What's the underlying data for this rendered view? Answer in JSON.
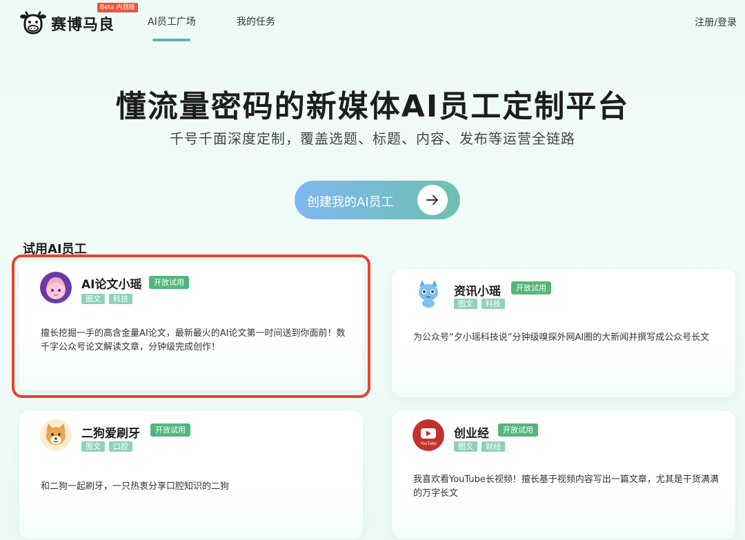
{
  "header": {
    "brand": "赛博马良",
    "beta": "Beta 内测版",
    "nav": [
      "AI员工广场",
      "我的任务"
    ],
    "login": "注册/登录"
  },
  "hero": {
    "title": "懂流量密码的新媒体AI员工定制平台",
    "subtitle": "千号千面深度定制，覆盖选题、标题、内容、发布等运营全链路",
    "cta": "创建我的AI员工"
  },
  "section": {
    "title": "试用AI员工"
  },
  "cards": [
    {
      "name": "AI论文小瑶",
      "badge": "开放试用",
      "tags": [
        "图文",
        "科技"
      ],
      "desc": "擅长挖掘一手的高含金量AI论文，最新最火的AI论文第一时间送到你面前！数千字公众号论文解读文章，分钟级完成创作！",
      "avatar": "anime-girl-avatar"
    },
    {
      "name": "资讯小瑶",
      "badge": "开放试用",
      "tags": [
        "图文",
        "科技"
      ],
      "desc": "为公众号“夕小瑶科技说”分钟级嗅探外网AI圈的大新闻并撰写成公众号长文",
      "avatar": "blue-dragon-avatar"
    },
    {
      "name": "二狗爱刷牙",
      "badge": "开放试用",
      "tags": [
        "图文",
        "口腔"
      ],
      "desc": "和二狗一起刷牙，一只热衷分享口腔知识的二狗",
      "avatar": "shiba-dog-avatar"
    },
    {
      "name": "创业经",
      "badge": "开放试用",
      "tags": [
        "图文",
        "财经"
      ],
      "desc": "我喜欢看YouTube长视频！擅长基于视频内容写出一篇文章，尤其是干货满满的万字长文",
      "avatar": "youtube-avatar",
      "avatar_text": "YouTube"
    }
  ]
}
